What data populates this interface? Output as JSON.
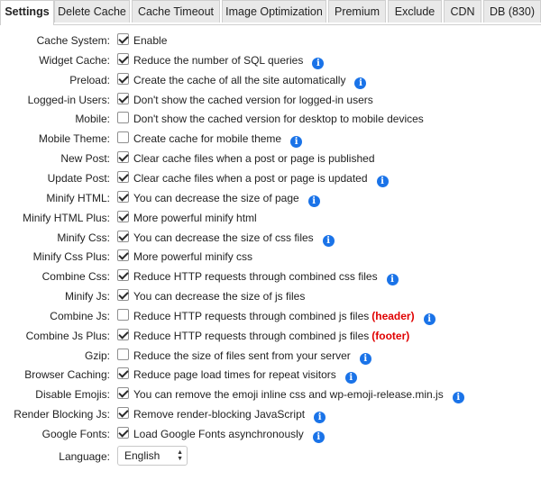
{
  "tabs": [
    {
      "label": "Settings",
      "active": true
    },
    {
      "label": "Delete Cache"
    },
    {
      "label": "Cache Timeout"
    },
    {
      "label": "Image Optimization"
    },
    {
      "label": "Premium"
    },
    {
      "label": "Exclude"
    },
    {
      "label": "CDN"
    },
    {
      "label": "DB (830)"
    }
  ],
  "settings": [
    {
      "label": "Cache System:",
      "checked": true,
      "desc": "Enable",
      "info": false
    },
    {
      "label": "Widget Cache:",
      "checked": true,
      "desc": "Reduce the number of SQL queries",
      "info": true
    },
    {
      "label": "Preload:",
      "checked": true,
      "desc": "Create the cache of all the site automatically",
      "info": true
    },
    {
      "label": "Logged-in Users:",
      "checked": true,
      "desc": "Don't show the cached version for logged-in users",
      "info": false
    },
    {
      "label": "Mobile:",
      "checked": false,
      "desc": "Don't show the cached version for desktop to mobile devices",
      "info": false
    },
    {
      "label": "Mobile Theme:",
      "checked": false,
      "desc": "Create cache for mobile theme",
      "info": true
    },
    {
      "label": "New Post:",
      "checked": true,
      "desc": "Clear cache files when a post or page is published",
      "info": false
    },
    {
      "label": "Update Post:",
      "checked": true,
      "desc": "Clear cache files when a post or page is updated",
      "info": true
    },
    {
      "label": "Minify HTML:",
      "checked": true,
      "desc": "You can decrease the size of page",
      "info": true
    },
    {
      "label": "Minify HTML Plus:",
      "checked": true,
      "desc": "More powerful minify html",
      "info": false
    },
    {
      "label": "Minify Css:",
      "checked": true,
      "desc": "You can decrease the size of css files",
      "info": true
    },
    {
      "label": "Minify Css Plus:",
      "checked": true,
      "desc": "More powerful minify css",
      "info": false
    },
    {
      "label": "Combine Css:",
      "checked": true,
      "desc": "Reduce HTTP requests through combined css files",
      "info": true
    },
    {
      "label": "Minify Js:",
      "checked": true,
      "desc": "You can decrease the size of js files",
      "info": false
    },
    {
      "label": "Combine Js:",
      "checked": false,
      "desc": "Reduce HTTP requests through combined js files",
      "note": "(header)",
      "info": true
    },
    {
      "label": "Combine Js Plus:",
      "checked": true,
      "desc": "Reduce HTTP requests through combined js files",
      "note": "(footer)",
      "info": false
    },
    {
      "label": "Gzip:",
      "checked": false,
      "desc": "Reduce the size of files sent from your server",
      "info": true
    },
    {
      "label": "Browser Caching:",
      "checked": true,
      "desc": "Reduce page load times for repeat visitors",
      "info": true
    },
    {
      "label": "Disable Emojis:",
      "checked": true,
      "desc": "You can remove the emoji inline css and wp-emoji-release.min.js",
      "info": true
    },
    {
      "label": "Render Blocking Js:",
      "checked": true,
      "desc": "Remove render-blocking JavaScript",
      "info": true
    },
    {
      "label": "Google Fonts:",
      "checked": true,
      "desc": "Load Google Fonts asynchronously",
      "info": true
    }
  ],
  "language": {
    "label": "Language:",
    "value": "English"
  },
  "info_glyph": "i",
  "colors": {
    "info_icon": "#1a73e8",
    "note_red": "#e00000",
    "tab_bg": "#e9e9e9"
  }
}
